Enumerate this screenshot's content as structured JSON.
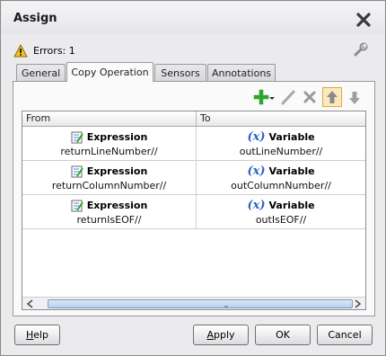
{
  "dialog": {
    "title": "Assign",
    "errors_label": "Errors: 1"
  },
  "tabs": [
    {
      "label": "General",
      "active": false
    },
    {
      "label": "Copy Operation",
      "active": true
    },
    {
      "label": "Sensors",
      "active": false
    },
    {
      "label": "Annotations",
      "active": false
    }
  ],
  "table": {
    "columns": [
      "From",
      "To"
    ],
    "rows": [
      {
        "from_kind": "Expression",
        "from_path": "returnLineNumber//",
        "to_kind": "Variable",
        "to_path": "outLineNumber//"
      },
      {
        "from_kind": "Expression",
        "from_path": "returnColumnNumber//",
        "to_kind": "Variable",
        "to_path": "outColumnNumber//"
      },
      {
        "from_kind": "Expression",
        "from_path": "returnIsEOF//",
        "to_kind": "Variable",
        "to_path": "outIsEOF//"
      }
    ],
    "variable_glyph": "(x)"
  },
  "toolbar": {
    "icons": [
      "add-icon",
      "edit-pencil-icon",
      "delete-icon",
      "move-up-icon",
      "move-down-icon"
    ]
  },
  "buttons": {
    "help_mnemonic": "H",
    "help_rest": "elp",
    "apply_mnemonic": "A",
    "apply_rest": "pply",
    "ok": "OK",
    "cancel": "Cancel"
  },
  "colors": {
    "accent_blue": "#2a64c8",
    "add_green": "#2fa52f",
    "warning_yellow": "#f2c230"
  }
}
